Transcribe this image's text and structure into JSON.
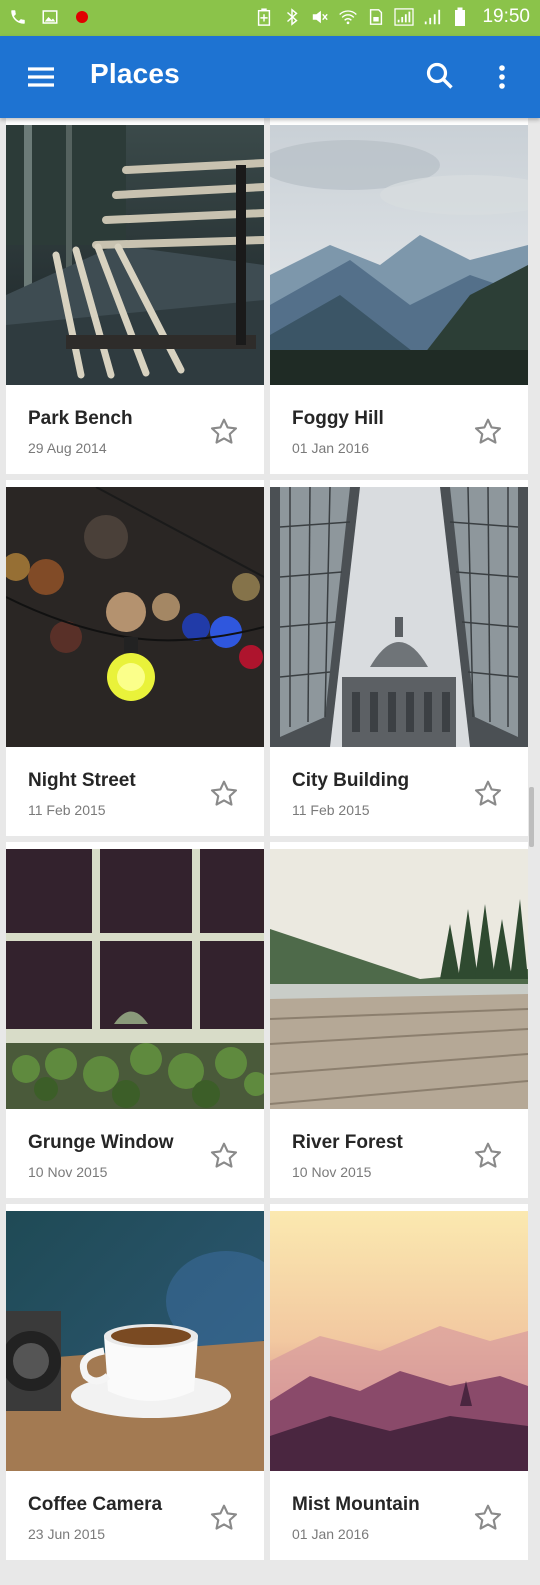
{
  "status_bar": {
    "time": "19:50",
    "left_icons": [
      "phone-icon",
      "image-icon",
      "record-dot-icon"
    ],
    "right_icons": [
      "battery-saver-icon",
      "bluetooth-icon",
      "mute-icon",
      "wifi-icon",
      "sim-icon",
      "signal-icon",
      "signal-icon",
      "battery-icon"
    ]
  },
  "app_bar": {
    "title": "Places",
    "menu_icon": "menu-icon",
    "search_icon": "search-icon",
    "more_icon": "more-vert-icon",
    "color": "#1e73d2"
  },
  "places": [
    {
      "title": "Park Bench",
      "date": "29 Aug 2014",
      "photo": "park-bench-photo"
    },
    {
      "title": "Foggy Hill",
      "date": "01 Jan 2016",
      "photo": "foggy-hill-photo"
    },
    {
      "title": "Night Street",
      "date": "11 Feb 2015",
      "photo": "night-street-photo"
    },
    {
      "title": "City Building",
      "date": "11 Feb 2015",
      "photo": "city-building-photo"
    },
    {
      "title": "Grunge Window",
      "date": "10 Nov 2015",
      "photo": "grunge-window-photo"
    },
    {
      "title": "River Forest",
      "date": "10 Nov 2015",
      "photo": "river-forest-photo"
    },
    {
      "title": "Coffee Camera",
      "date": "23 Jun 2015",
      "photo": "coffee-camera-photo"
    },
    {
      "title": "Mist Mountain",
      "date": "01 Jan 2016",
      "photo": "mist-mountain-photo"
    }
  ]
}
